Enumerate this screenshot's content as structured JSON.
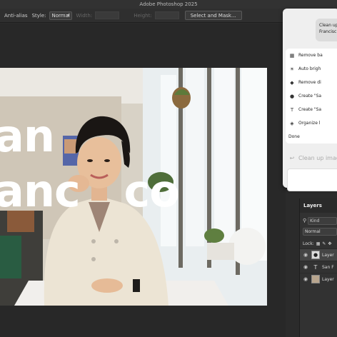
{
  "window": {
    "title": "Adobe Photoshop 2025"
  },
  "options_bar": {
    "anti_alias": "Anti-alias",
    "style_label": "Style:",
    "style_value": "Normal",
    "width_label": "Width:",
    "height_label": "Height:",
    "select_mask_button": "Select and Mask..."
  },
  "canvas": {
    "overlay_text_line1": "an",
    "overlay_text_line2": "anc   co"
  },
  "contextual_panel": {
    "prompt_line1": "Clean up",
    "prompt_line2": "Francisc",
    "actions": [
      {
        "icon": "remove-background-icon",
        "label": "Remove ba"
      },
      {
        "icon": "auto-brightness-icon",
        "label": "Auto brigh"
      },
      {
        "icon": "remove-distractions-icon",
        "label": "Remove di"
      },
      {
        "icon": "person-icon",
        "label": "Create \"Sa"
      },
      {
        "icon": "text-icon",
        "label": "Create \"Sa"
      },
      {
        "icon": "layers-icon",
        "label": "Organize l"
      }
    ],
    "done_label": "Done",
    "input_placeholder": "Clean up imag"
  },
  "layers_panel": {
    "tab": "Layers",
    "filter_kind": "Kind",
    "blend_mode": "Normal",
    "lock_label": "Lock:",
    "layers": [
      {
        "name": "Layer",
        "type": "image",
        "selected": true
      },
      {
        "name": "San F",
        "type": "text",
        "selected": false
      },
      {
        "name": "Layer",
        "type": "image",
        "selected": false
      }
    ]
  },
  "colors": {
    "app_bg": "#2b2b2b",
    "panel_light": "#efefef",
    "text_overlay": "#ffffff"
  }
}
